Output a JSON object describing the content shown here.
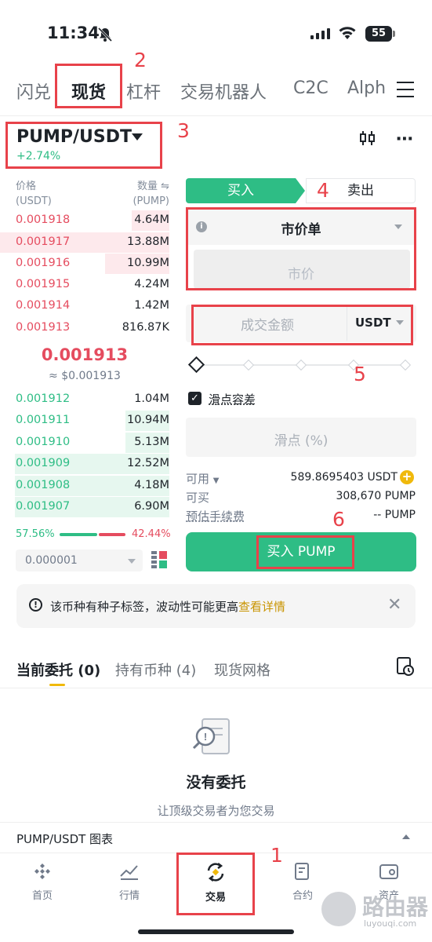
{
  "status": {
    "time": "11:34",
    "battery": "55"
  },
  "nav_tabs": [
    {
      "label": "闪兑"
    },
    {
      "label": "现货"
    },
    {
      "label": "杠杆"
    },
    {
      "label": "交易机器人"
    },
    {
      "label": "C2C"
    },
    {
      "label": "Alph"
    }
  ],
  "annotations": [
    "1",
    "2",
    "3",
    "4",
    "5",
    "6"
  ],
  "pair": {
    "name": "PUMP/USDT",
    "change": "+2.74%"
  },
  "orderbook": {
    "price_header": "价格",
    "price_unit": "(USDT)",
    "qty_header": "数量 ⇋",
    "qty_unit": "(PUMP)",
    "asks": [
      {
        "price": "0.001918",
        "qty": "4.64M"
      },
      {
        "price": "0.001917",
        "qty": "13.88M"
      },
      {
        "price": "0.001916",
        "qty": "10.99M"
      },
      {
        "price": "0.001915",
        "qty": "4.24M"
      },
      {
        "price": "0.001914",
        "qty": "1.42M"
      },
      {
        "price": "0.001913",
        "qty": "816.87K"
      }
    ],
    "last_price": "0.001913",
    "last_price_usd": "≈ $0.001913",
    "bids": [
      {
        "price": "0.001912",
        "qty": "1.04M"
      },
      {
        "price": "0.001911",
        "qty": "10.94M"
      },
      {
        "price": "0.001910",
        "qty": "5.13M"
      },
      {
        "price": "0.001909",
        "qty": "12.52M"
      },
      {
        "price": "0.001908",
        "qty": "4.18M"
      },
      {
        "price": "0.001907",
        "qty": "6.90M"
      }
    ],
    "buy_ratio": "57.56%",
    "sell_ratio": "42.44%",
    "precision": "0.000001"
  },
  "trade": {
    "buy_tab": "买入",
    "sell_tab": "卖出",
    "order_type": "市价单",
    "market_placeholder": "市价",
    "amount_placeholder": "成交金额",
    "amount_unit": "USDT",
    "slippage_label": "滑点容差",
    "slippage_placeholder": "滑点 (%)",
    "available_label": "可用",
    "available_value": "589.8695403 USDT",
    "can_buy_label": "可买",
    "can_buy_value": "308,670 PUMP",
    "fee_label": "预估手续费",
    "fee_value": "-- PUMP",
    "buy_button": "买入 PUMP"
  },
  "notice": {
    "text": "该币种有种子标签，波动性可能更高",
    "link": "查看详情"
  },
  "order_tabs": [
    {
      "label": "当前委托 (0)"
    },
    {
      "label": "持有币种 (4)"
    },
    {
      "label": "现货网格"
    }
  ],
  "empty": {
    "title": "没有委托",
    "subtitle": "让顶级交易者为您交易"
  },
  "chart_bar": {
    "label": "PUMP/USDT 图表"
  },
  "bottom_nav": [
    {
      "label": "首页"
    },
    {
      "label": "行情"
    },
    {
      "label": "交易"
    },
    {
      "label": "合约"
    },
    {
      "label": "资产"
    }
  ],
  "watermark": {
    "name": "路由器",
    "url": "luyouqi.com"
  },
  "colors": {
    "buy": "#2ebd85",
    "sell": "#e54c5f",
    "accent": "#f0b90b",
    "annotation": "#e8424a"
  }
}
